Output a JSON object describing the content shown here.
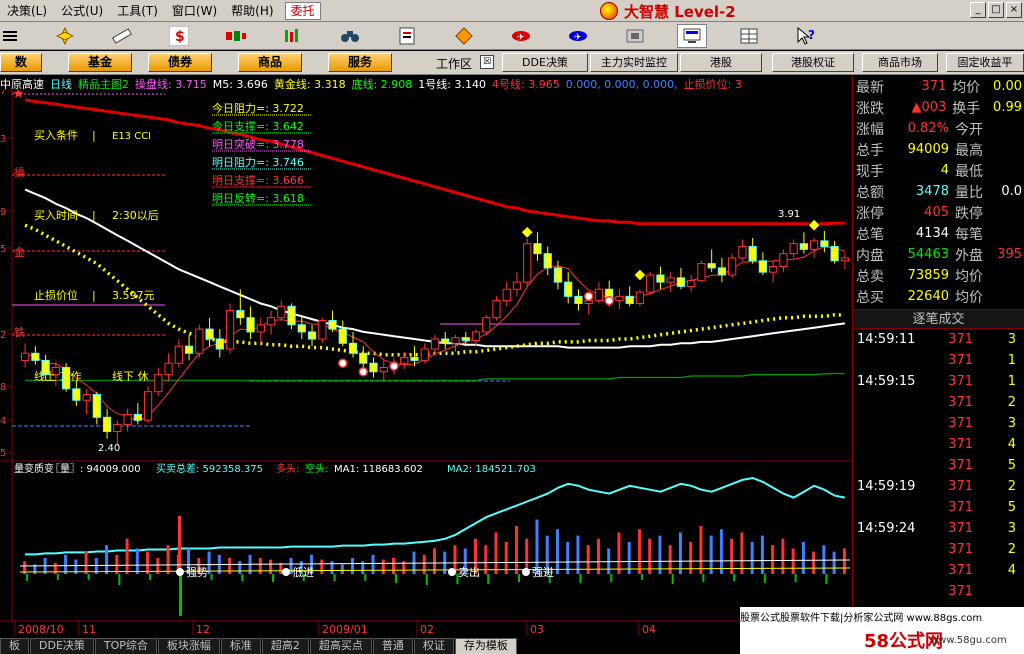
{
  "menu": {
    "items": [
      "决策(L)",
      "公式(U)",
      "工具(T)",
      "窗口(W)",
      "帮助(H)"
    ],
    "active": "委托",
    "brand": "大智慧 Level-2",
    "win_controls": [
      "_",
      "□",
      "×"
    ]
  },
  "toolbar": {
    "icons": [
      "menu-icon",
      "move-icon",
      "ruler-icon",
      "dollar-icon",
      "candle-icon",
      "bars-icon",
      "binoculars-icon",
      "info-icon",
      "diamond-icon",
      "plane-icon",
      "plane2-icon",
      "chip-icon",
      "monitor-icon",
      "grid-icon",
      "help-cursor-icon"
    ]
  },
  "buttons": {
    "left": [
      "数",
      "基金",
      "债券",
      "商品",
      "服务"
    ],
    "workspace": "工作区",
    "right": [
      "DDE决策",
      "主力实时监控",
      "港股",
      "港股权证",
      "商品市场",
      "固定收益平"
    ]
  },
  "title": {
    "stock": "中原高速",
    "period": "日线",
    "template": "精品主图2",
    "items": [
      {
        "label": "操盘线: 3.715",
        "color": "#ff54ff"
      },
      {
        "label": "M5: 3.696",
        "color": "#ffffff"
      },
      {
        "label": "黄金线: 3.318",
        "color": "#ffff00"
      },
      {
        "label": "底线: 2.908",
        "color": "#00ff00"
      },
      {
        "label": "1号线: 3.140",
        "color": "#ffffff"
      },
      {
        "label": "4号线: 3.965",
        "color": "#ff3232"
      },
      {
        "label": "0.000, 0.000, 0.000,",
        "color": "#4080ff"
      },
      {
        "label": "止损价位: 3",
        "color": "#ff3232"
      }
    ]
  },
  "chart_data": {
    "type": "candlestick",
    "y_ticks": [
      "7",
      "3",
      "9",
      "5",
      "2",
      "8",
      "4",
      "5"
    ],
    "price_levels": [
      {
        "label": "操",
        "color": "#ff3232"
      },
      {
        "label": "金",
        "color": "#ff3232"
      },
      {
        "label": "铁",
        "color": "#ff3232"
      }
    ],
    "annotations": {
      "buy_condition": "买入条件",
      "buy_condition_value": "E13 CCI",
      "buy_time": "买入时间",
      "buy_time_value": "2:30以后",
      "stop_loss": "止损价位",
      "stop_loss_value": "3.597元",
      "line_work": "线上 工作",
      "line_rest": "线下 休",
      "high_label": "3.91",
      "low_label": "2.40"
    },
    "forecast": [
      {
        "label": "今日阻力=: 3.722",
        "color": "#ffff00"
      },
      {
        "label": "今日支撑=: 3.642",
        "color": "#00ff00"
      },
      {
        "label": "明日突破=: 3.778",
        "color": "#ff54ff"
      },
      {
        "label": "明日阻力=: 3.746",
        "color": "#54ffff"
      },
      {
        "label": "明日支撑=: 3.666",
        "color": "#ff3232"
      },
      {
        "label": "明日反转=: 3.618",
        "color": "#00ff00"
      }
    ],
    "volume_panel": {
      "items": [
        {
          "label": "量变质变",
          "color": "#ffffff"
        },
        {
          "label": "〖量〗: 94009.000",
          "color": "#ffffff"
        },
        {
          "label": "买卖总差: 592358.375",
          "color": "#54ffff"
        },
        {
          "label": "多头:",
          "color": "#ff3232"
        },
        {
          "label": "空头:",
          "color": "#00ff00"
        },
        {
          "label": "MA1: 118683.602",
          "color": "#ffffff"
        },
        {
          "label": "MA2: 184521.703",
          "color": "#54ffff"
        }
      ],
      "marks": [
        "强势",
        "低进",
        "卖出",
        "强进"
      ]
    },
    "x_labels": [
      "2008/10",
      "11",
      "12",
      "2009/01",
      "02",
      "03",
      "04"
    ],
    "candles": [
      [
        3.0,
        3.12,
        2.95,
        3.05
      ],
      [
        3.05,
        3.1,
        2.97,
        3.0
      ],
      [
        3.0,
        3.04,
        2.86,
        2.9
      ],
      [
        2.9,
        2.99,
        2.82,
        2.95
      ],
      [
        2.95,
        2.98,
        2.78,
        2.8
      ],
      [
        2.8,
        2.86,
        2.68,
        2.72
      ],
      [
        2.72,
        2.8,
        2.62,
        2.76
      ],
      [
        2.76,
        2.78,
        2.55,
        2.6
      ],
      [
        2.6,
        2.66,
        2.45,
        2.5
      ],
      [
        2.5,
        2.58,
        2.4,
        2.55
      ],
      [
        2.55,
        2.66,
        2.5,
        2.62
      ],
      [
        2.62,
        2.7,
        2.55,
        2.58
      ],
      [
        2.58,
        2.82,
        2.56,
        2.78
      ],
      [
        2.78,
        2.95,
        2.75,
        2.9
      ],
      [
        2.9,
        3.05,
        2.85,
        2.98
      ],
      [
        2.98,
        3.15,
        2.95,
        3.1
      ],
      [
        3.1,
        3.18,
        3.0,
        3.05
      ],
      [
        3.05,
        3.25,
        3.02,
        3.22
      ],
      [
        3.22,
        3.3,
        3.1,
        3.15
      ],
      [
        3.15,
        3.22,
        3.02,
        3.08
      ],
      [
        3.08,
        3.4,
        3.05,
        3.35
      ],
      [
        3.35,
        3.5,
        3.25,
        3.3
      ],
      [
        3.3,
        3.38,
        3.15,
        3.2
      ],
      [
        3.2,
        3.3,
        3.12,
        3.25
      ],
      [
        3.25,
        3.35,
        3.18,
        3.3
      ],
      [
        3.3,
        3.42,
        3.28,
        3.38
      ],
      [
        3.38,
        3.4,
        3.22,
        3.25
      ],
      [
        3.25,
        3.32,
        3.15,
        3.2
      ],
      [
        3.2,
        3.25,
        3.1,
        3.15
      ],
      [
        3.15,
        3.3,
        3.12,
        3.28
      ],
      [
        3.28,
        3.35,
        3.2,
        3.22
      ],
      [
        3.22,
        3.28,
        3.1,
        3.12
      ],
      [
        3.12,
        3.2,
        3.02,
        3.05
      ],
      [
        3.05,
        3.1,
        2.95,
        2.98
      ],
      [
        2.98,
        3.02,
        2.88,
        2.92
      ],
      [
        2.92,
        3.0,
        2.85,
        2.95
      ],
      [
        2.95,
        3.02,
        2.9,
        2.98
      ],
      [
        2.98,
        3.06,
        2.94,
        3.02
      ],
      [
        3.02,
        3.1,
        2.96,
        3.0
      ],
      [
        3.0,
        3.12,
        2.98,
        3.08
      ],
      [
        3.08,
        3.18,
        3.05,
        3.15
      ],
      [
        3.15,
        3.2,
        3.08,
        3.12
      ],
      [
        3.12,
        3.18,
        3.06,
        3.16
      ],
      [
        3.16,
        3.2,
        3.1,
        3.14
      ],
      [
        3.14,
        3.22,
        3.1,
        3.2
      ],
      [
        3.2,
        3.32,
        3.18,
        3.3
      ],
      [
        3.3,
        3.45,
        3.28,
        3.42
      ],
      [
        3.42,
        3.55,
        3.38,
        3.5
      ],
      [
        3.5,
        3.62,
        3.45,
        3.55
      ],
      [
        3.55,
        3.88,
        3.52,
        3.82
      ],
      [
        3.82,
        3.9,
        3.7,
        3.75
      ],
      [
        3.75,
        3.8,
        3.6,
        3.65
      ],
      [
        3.65,
        3.7,
        3.5,
        3.55
      ],
      [
        3.55,
        3.62,
        3.4,
        3.45
      ],
      [
        3.45,
        3.5,
        3.35,
        3.4
      ],
      [
        3.4,
        3.48,
        3.32,
        3.42
      ],
      [
        3.42,
        3.55,
        3.4,
        3.5
      ],
      [
        3.5,
        3.56,
        3.38,
        3.42
      ],
      [
        3.42,
        3.5,
        3.36,
        3.45
      ],
      [
        3.45,
        3.52,
        3.38,
        3.4
      ],
      [
        3.4,
        3.5,
        3.38,
        3.48
      ],
      [
        3.48,
        3.62,
        3.46,
        3.6
      ],
      [
        3.6,
        3.66,
        3.5,
        3.55
      ],
      [
        3.55,
        3.62,
        3.48,
        3.58
      ],
      [
        3.58,
        3.65,
        3.5,
        3.52
      ],
      [
        3.52,
        3.6,
        3.48,
        3.56
      ],
      [
        3.56,
        3.7,
        3.55,
        3.68
      ],
      [
        3.68,
        3.78,
        3.62,
        3.65
      ],
      [
        3.65,
        3.72,
        3.55,
        3.6
      ],
      [
        3.6,
        3.75,
        3.58,
        3.72
      ],
      [
        3.72,
        3.85,
        3.7,
        3.8
      ],
      [
        3.8,
        3.86,
        3.68,
        3.7
      ],
      [
        3.7,
        3.76,
        3.6,
        3.62
      ],
      [
        3.62,
        3.7,
        3.55,
        3.66
      ],
      [
        3.66,
        3.78,
        3.62,
        3.75
      ],
      [
        3.75,
        3.85,
        3.72,
        3.82
      ],
      [
        3.82,
        3.9,
        3.75,
        3.78
      ],
      [
        3.78,
        3.86,
        3.72,
        3.84
      ],
      [
        3.84,
        3.91,
        3.76,
        3.8
      ],
      [
        3.8,
        3.84,
        3.68,
        3.7
      ],
      [
        3.7,
        3.76,
        3.64,
        3.72
      ]
    ],
    "ma_white": [
      4.2,
      4.17,
      4.14,
      4.1,
      4.07,
      4.03,
      4.0,
      3.96,
      3.92,
      3.88,
      3.84,
      3.8,
      3.76,
      3.72,
      3.68,
      3.64,
      3.61,
      3.58,
      3.55,
      3.52,
      3.49,
      3.46,
      3.43,
      3.4,
      3.38,
      3.35,
      3.33,
      3.31,
      3.29,
      3.27,
      3.25,
      3.23,
      3.22,
      3.2,
      3.19,
      3.18,
      3.17,
      3.16,
      3.15,
      3.14,
      3.13,
      3.12,
      3.12,
      3.11,
      3.11,
      3.1,
      3.1,
      3.1,
      3.1,
      3.1,
      3.1,
      3.1,
      3.1,
      3.09,
      3.09,
      3.09,
      3.09,
      3.09,
      3.09,
      3.1,
      3.1,
      3.1,
      3.11,
      3.11,
      3.12,
      3.12,
      3.13,
      3.13,
      3.14,
      3.15,
      3.16,
      3.17,
      3.18,
      3.19,
      3.2,
      3.21,
      3.22,
      3.23,
      3.24,
      3.25,
      3.26
    ],
    "ma_red": [
      4.83,
      4.82,
      4.81,
      4.8,
      4.79,
      4.78,
      4.77,
      4.76,
      4.75,
      4.74,
      4.73,
      4.72,
      4.71,
      4.7,
      4.69,
      4.67,
      4.66,
      4.65,
      4.63,
      4.62,
      4.6,
      4.59,
      4.57,
      4.55,
      4.54,
      4.52,
      4.5,
      4.48,
      4.46,
      4.44,
      4.42,
      4.4,
      4.38,
      4.36,
      4.34,
      4.32,
      4.3,
      4.28,
      4.26,
      4.24,
      4.22,
      4.2,
      4.18,
      4.16,
      4.14,
      4.12,
      4.1,
      4.08,
      4.07,
      4.05,
      4.04,
      4.03,
      4.02,
      4.01,
      4.0,
      3.99,
      3.98,
      3.98,
      3.97,
      3.97,
      3.96,
      3.96,
      3.96,
      3.96,
      3.96,
      3.96,
      3.96,
      3.96,
      3.96,
      3.96,
      3.96,
      3.96,
      3.96,
      3.96,
      3.96,
      3.96,
      3.96,
      3.96,
      3.96,
      3.965,
      3.965
    ],
    "ma_yellow": [
      3.95,
      3.92,
      3.88,
      3.84,
      3.8,
      3.76,
      3.72,
      3.68,
      3.62,
      3.56,
      3.5,
      3.44,
      3.38,
      3.32,
      3.26,
      3.22,
      3.19,
      3.17,
      3.15,
      3.14,
      3.13,
      3.13,
      3.12,
      3.12,
      3.11,
      3.11,
      3.1,
      3.1,
      3.09,
      3.09,
      3.08,
      3.07,
      3.06,
      3.05,
      3.05,
      3.04,
      3.04,
      3.04,
      3.04,
      3.04,
      3.05,
      3.05,
      3.05,
      3.06,
      3.06,
      3.07,
      3.08,
      3.09,
      3.1,
      3.11,
      3.12,
      3.12,
      3.13,
      3.13,
      3.13,
      3.14,
      3.14,
      3.14,
      3.15,
      3.15,
      3.16,
      3.17,
      3.18,
      3.19,
      3.2,
      3.21,
      3.22,
      3.23,
      3.24,
      3.25,
      3.26,
      3.27,
      3.28,
      3.29,
      3.3,
      3.3,
      3.31,
      3.31,
      3.31,
      3.32,
      3.318
    ],
    "ma_green": [
      2.86,
      2.86,
      2.86,
      2.86,
      2.86,
      2.86,
      2.86,
      2.86,
      2.86,
      2.86,
      2.86,
      2.86,
      2.86,
      2.86,
      2.86,
      2.86,
      2.86,
      2.86,
      2.86,
      2.86,
      2.86,
      2.86,
      2.86,
      2.86,
      2.86,
      2.86,
      2.86,
      2.86,
      2.86,
      2.86,
      2.86,
      2.86,
      2.86,
      2.86,
      2.86,
      2.86,
      2.86,
      2.86,
      2.86,
      2.86,
      2.86,
      2.86,
      2.86,
      2.86,
      2.86,
      2.87,
      2.87,
      2.87,
      2.87,
      2.87,
      2.87,
      2.87,
      2.87,
      2.87,
      2.87,
      2.87,
      2.87,
      2.87,
      2.88,
      2.88,
      2.88,
      2.88,
      2.88,
      2.88,
      2.88,
      2.89,
      2.89,
      2.89,
      2.89,
      2.89,
      2.89,
      2.9,
      2.9,
      2.9,
      2.9,
      2.9,
      2.9,
      2.9,
      2.905,
      2.908,
      2.908
    ],
    "volume_line": [
      20,
      20,
      21,
      21,
      22,
      22,
      22,
      23,
      23,
      24,
      24,
      24,
      25,
      25,
      25,
      26,
      26,
      26,
      26,
      27,
      27,
      27,
      27,
      27,
      27,
      27,
      28,
      28,
      28,
      28,
      28,
      29,
      29,
      29,
      30,
      30,
      31,
      31,
      32,
      33,
      34,
      36,
      40,
      46,
      52,
      58,
      62,
      66,
      70,
      74,
      78,
      82,
      88,
      92,
      90,
      86,
      84,
      82,
      86,
      90,
      88,
      86,
      84,
      88,
      92,
      90,
      86,
      84,
      88,
      92,
      96,
      98,
      94,
      88,
      82,
      78,
      84,
      90,
      86,
      80,
      78
    ],
    "volume_bars": [
      8,
      6,
      10,
      7,
      12,
      9,
      14,
      10,
      18,
      12,
      22,
      16,
      14,
      10,
      18,
      12,
      16,
      10,
      14,
      12,
      10,
      8,
      12,
      10,
      9,
      7,
      10,
      8,
      12,
      9,
      8,
      6,
      10,
      8,
      12,
      9,
      10,
      8,
      14,
      12,
      16,
      14,
      18,
      16,
      22,
      18,
      26,
      20,
      30,
      22,
      34,
      24,
      28,
      20,
      24,
      18,
      22,
      16,
      26,
      20,
      28,
      22,
      24,
      18,
      26,
      20,
      30,
      24,
      28,
      22,
      26,
      20,
      24,
      18,
      22,
      16,
      20,
      14,
      18,
      14,
      16
    ]
  },
  "quote": {
    "rows": [
      {
        "l1": "最新",
        "v1": "371",
        "c1": "#ff3232",
        "l2": "均价",
        "v2": "0.00",
        "c2": "#ffff00"
      },
      {
        "l1": "涨跌",
        "v1": "▲003",
        "c1": "#ff3232",
        "l2": "换手",
        "v2": "0.99",
        "c2": "#ffff00"
      },
      {
        "l1": "涨幅",
        "v1": "0.82%",
        "c1": "#ff3232",
        "l2": "今开",
        "v2": "",
        "c2": "#ffffff"
      },
      {
        "l1": "总手",
        "v1": "94009",
        "c1": "#ffff00",
        "l2": "最高",
        "v2": "",
        "c2": "#ffffff"
      },
      {
        "l1": "现手",
        "v1": "4",
        "c1": "#ffff00",
        "l2": "最低",
        "v2": "",
        "c2": "#ffffff"
      },
      {
        "l1": "总额",
        "v1": "3478",
        "c1": "#54ffff",
        "l2": "量比",
        "v2": "0.0",
        "c2": "#ffffff"
      },
      {
        "l1": "涨停",
        "v1": "405",
        "c1": "#ff3232",
        "l2": "跌停",
        "v2": "",
        "c2": "#ffffff"
      },
      {
        "l1": "总笔",
        "v1": "4134",
        "c1": "#ffffff",
        "l2": "每笔",
        "v2": "",
        "c2": "#ffffff"
      },
      {
        "l1": "内盘",
        "v1": "54463",
        "c1": "#00e600",
        "l2": "外盘",
        "v2": "395",
        "c2": "#ff3232"
      },
      {
        "l1": "总卖",
        "v1": "73859",
        "c1": "#ffff00",
        "l2": "均价",
        "v2": "",
        "c2": "#ffffff"
      },
      {
        "l1": "总买",
        "v1": "22640",
        "c1": "#ffff00",
        "l2": "均价",
        "v2": "",
        "c2": "#ffffff"
      }
    ],
    "ticks_title": "逐笔成交",
    "ticks": [
      {
        "time": "14:59:11",
        "price": "371",
        "vol": "3",
        "cyan": false
      },
      {
        "time": "",
        "price": "371",
        "vol": "1",
        "cyan": false
      },
      {
        "time": "14:59:15",
        "price": "371",
        "vol": "1",
        "cyan": false
      },
      {
        "time": "",
        "price": "371",
        "vol": "2",
        "cyan": false
      },
      {
        "time": "",
        "price": "371",
        "vol": "3",
        "cyan": false
      },
      {
        "time": "",
        "price": "371",
        "vol": "4",
        "cyan": false
      },
      {
        "time": "",
        "price": "371",
        "vol": "5",
        "cyan": false
      },
      {
        "time": "14:59:19",
        "price": "371",
        "vol": "2",
        "cyan": false
      },
      {
        "time": "",
        "price": "371",
        "vol": "5",
        "cyan": false
      },
      {
        "time": "14:59:24",
        "price": "371",
        "vol": "3",
        "cyan": false
      },
      {
        "time": "",
        "price": "371",
        "vol": "2",
        "cyan": false
      },
      {
        "time": "",
        "price": "371",
        "vol": "4",
        "cyan": false
      },
      {
        "time": "",
        "price": "371",
        "vol": "",
        "cyan": false
      }
    ]
  },
  "tabs": [
    "板",
    "DDE决策",
    "TOP综合",
    "板块涨幅",
    "标准",
    "超高2",
    "超高买点",
    "普通",
    "权证",
    "存为模板"
  ],
  "tab_active": "存为模板",
  "footer": {
    "text": "股票公式股票软件下载|分析家公式网 www.88gs.com",
    "logo": "58公式网",
    "url": "www.58gu.com"
  }
}
